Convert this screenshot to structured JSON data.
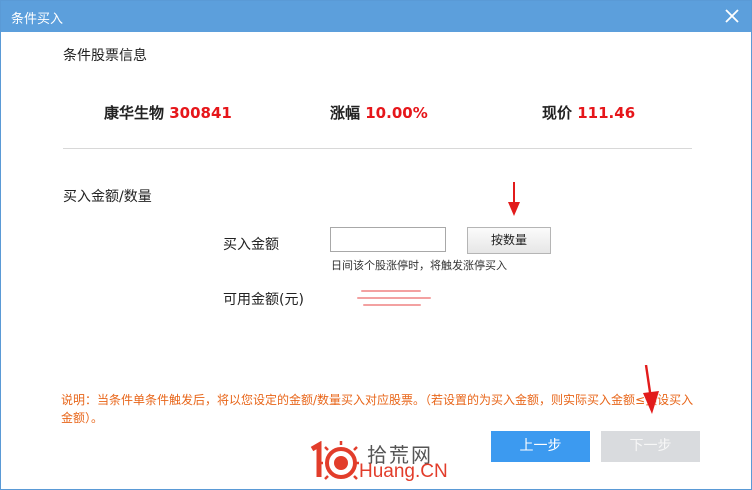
{
  "window": {
    "title": "条件买入"
  },
  "stock_info": {
    "section_title": "条件股票信息",
    "name": "康华生物",
    "code": "300841",
    "change_label": "涨幅",
    "change_value": "10.00%",
    "price_label": "现价",
    "price_value": "111.46"
  },
  "amount_section": {
    "section_title": "买入金额/数量",
    "amount_label": "买入金额",
    "amount_value": "",
    "by_quantity_button": "按数量",
    "hint": "日间该个股涨停时，将触发涨停买入",
    "available_label": "可用金额(元)"
  },
  "note": "说明：当条件单条件触发后，将以您设定的金额/数量买入对应股票。（若设置的为买入金额，则实际买入金额≤预设买入金额）。",
  "buttons": {
    "prev": "上一步",
    "next": "下一步"
  },
  "watermark": {
    "cn": "拾荒网",
    "en": "Huang.CN"
  },
  "colors": {
    "accent": "#3c9af0",
    "titlebar": "#5c9fdc",
    "price_red": "#e6161a",
    "note_orange": "#e8661a"
  }
}
